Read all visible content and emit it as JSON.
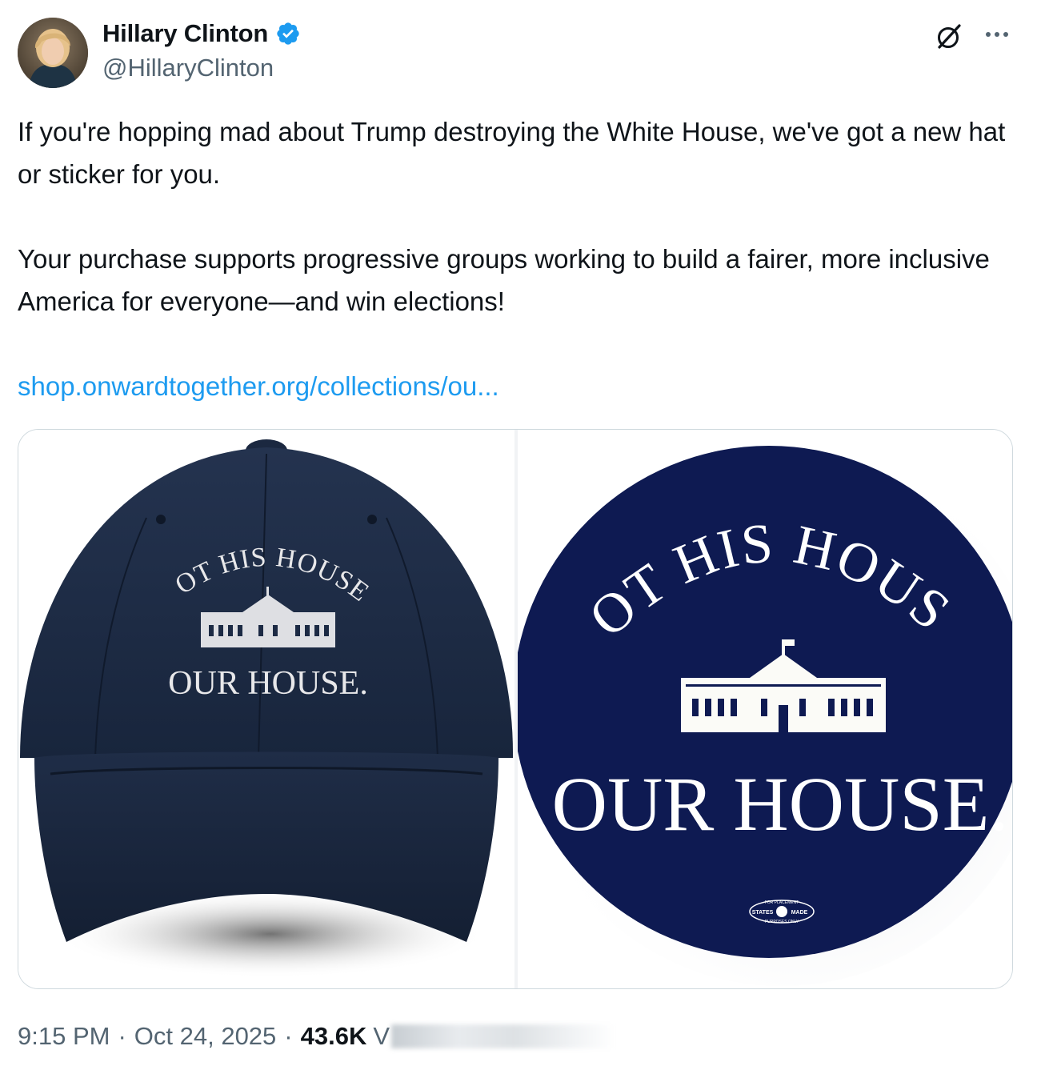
{
  "author": {
    "display_name": "Hillary Clinton",
    "handle": "@HillaryClinton",
    "verified": true
  },
  "tweet": {
    "paragraph1": "If you're hopping mad about Trump destroying the White House, we've got a new hat or sticker for you.",
    "paragraph2": "Your purchase supports progressive groups working to build a fairer, more inclusive America for everyone—and win elections!",
    "link": "shop.onwardtogether.org/collections/ou..."
  },
  "media": {
    "hat": {
      "line1": "NOT HIS HOUSE.",
      "line2": "OUR HOUSE."
    },
    "sticker": {
      "line1": "NOT HIS HOUSE.",
      "line2": "OUR HOUSE.",
      "badge_top": "FOR PLACEMENT",
      "badge_left": "STATES",
      "badge_right": "MADE",
      "badge_bottom": "PURPOSES ONLY"
    }
  },
  "meta": {
    "time": "9:15 PM",
    "date": "Oct 24, 2025",
    "separator": "·",
    "views_count": "43.6K",
    "views_label": "V"
  },
  "colors": {
    "link": "#1d9bf0",
    "verified_badge": "#1d9bf0",
    "hat_navy": "#1c2a44",
    "sticker_navy": "#0e1a52",
    "secondary_text": "#536471"
  },
  "icons": {
    "verified": "verified-badge-icon",
    "grok": "grok-icon",
    "more": "more-horizontal-icon"
  }
}
